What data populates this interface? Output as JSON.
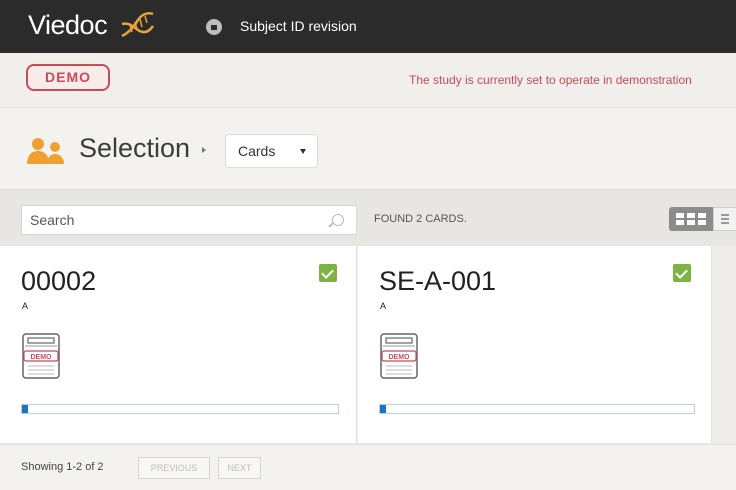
{
  "header": {
    "logo_text": "Viedoc",
    "title": "Subject ID revision"
  },
  "demo": {
    "badge": "DEMO",
    "message": "The study is currently set to operate in demonstration"
  },
  "selection": {
    "title": "Selection",
    "dropdown_value": "Cards"
  },
  "toolbar": {
    "search_placeholder": "Search",
    "found_text": "FOUND 2 CARDS."
  },
  "cards": [
    {
      "id": "00002",
      "sub": "A",
      "checked": true,
      "doc_badge": "DEMO",
      "progress": 0.01
    },
    {
      "id": "SE-A-001",
      "sub": "A",
      "checked": true,
      "doc_badge": "DEMO",
      "progress": 0.01
    }
  ],
  "pagination": {
    "showing": "Showing 1-2 of 2",
    "previous": "PREVIOUS",
    "next": "NEXT"
  },
  "colors": {
    "topbar": "#2b2b2b",
    "demo_red": "#c84b5a",
    "check_green": "#7cb342",
    "person_orange": "#f0a030",
    "progress_blue": "#1e73be"
  }
}
